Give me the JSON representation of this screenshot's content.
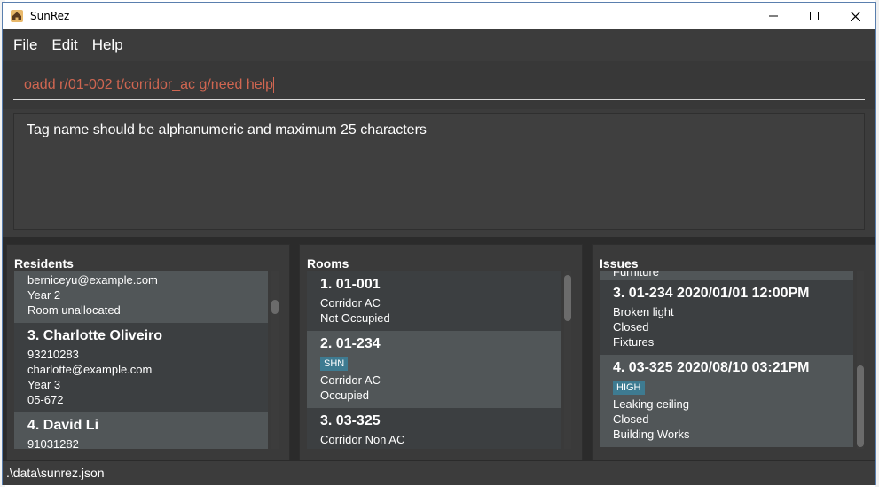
{
  "window": {
    "title": "SunRez"
  },
  "menu": {
    "file": "File",
    "edit": "Edit",
    "help": "Help"
  },
  "command": {
    "value": "oadd r/01-002 t/corridor_ac g/need help"
  },
  "result": {
    "text": "Tag name should be alphanumeric and maximum 25 characters"
  },
  "residents": {
    "title": "Residents",
    "items": [
      {
        "lines": [
          "berniceyu@example.com",
          "Year 2",
          "Room unallocated"
        ]
      },
      {
        "head": "3.  Charlotte Oliveiro",
        "lines": [
          "93210283",
          "charlotte@example.com",
          "Year 3",
          "05-672"
        ]
      },
      {
        "head": "4.  David Li",
        "lines": [
          "91031282"
        ]
      }
    ]
  },
  "rooms": {
    "title": "Rooms",
    "items": [
      {
        "head": "1.  01-001",
        "lines": [
          "Corridor AC",
          "Not Occupied"
        ]
      },
      {
        "head": "2.  01-234",
        "tag": "SHN",
        "lines": [
          "Corridor AC",
          "Occupied"
        ]
      },
      {
        "head": "3.  03-325",
        "lines": [
          "Corridor Non AC"
        ]
      }
    ]
  },
  "issues": {
    "title": "Issues",
    "items": [
      {
        "lines": [
          "Furniture"
        ]
      },
      {
        "head": "3.  01-234 2020/01/01 12:00PM",
        "lines": [
          "Broken light",
          "Closed",
          "Fixtures"
        ]
      },
      {
        "head": "4.  03-325 2020/08/10 03:21PM",
        "tag": "HIGH",
        "lines": [
          "Leaking ceiling",
          "Closed",
          "Building Works"
        ]
      }
    ]
  },
  "status": {
    "path": ".\\data\\sunrez.json"
  },
  "colors": {
    "accent_tag": "#3e7b91",
    "command_text": "#d06651",
    "background": "#3c3c3c"
  },
  "icons": {
    "app": "house-icon",
    "minimize": "minimize-icon",
    "maximize": "maximize-icon",
    "close": "close-icon"
  }
}
